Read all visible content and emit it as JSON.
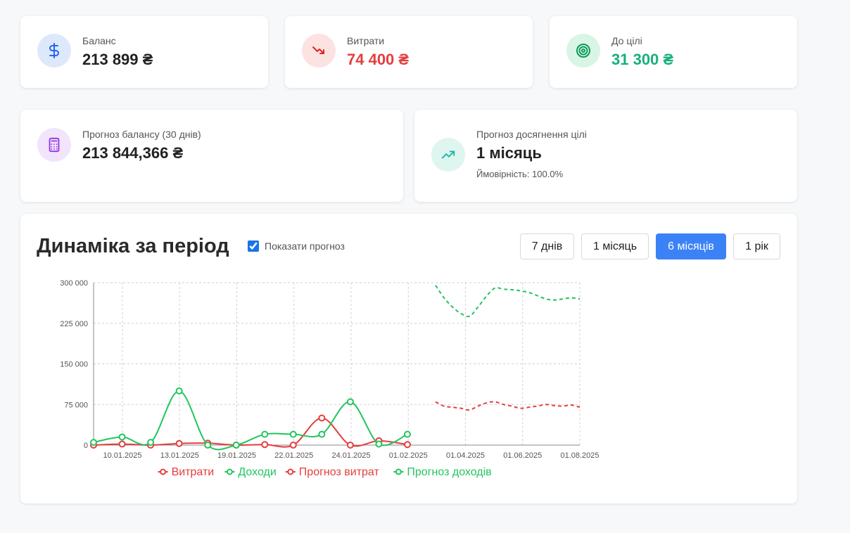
{
  "stats_row1": [
    {
      "label": "Баланс",
      "value": "213 899 ₴",
      "icon": "dollar-icon",
      "value_color": "#222222",
      "icon_bg": "#dde9fb",
      "icon_color": "#2563eb"
    },
    {
      "label": "Витрати",
      "value": "74 400 ₴",
      "icon": "trending-down-icon",
      "value_color": "#e53e3e",
      "icon_bg": "#fde2e2",
      "icon_color": "#dc2626"
    },
    {
      "label": "До цілі",
      "value": "31 300 ₴",
      "icon": "target-icon",
      "value_color": "#16b07a",
      "icon_bg": "#d8f5e6",
      "icon_color": "#0f9d58"
    }
  ],
  "forecast_balance": {
    "label": "Прогноз балансу (30 днів)",
    "value": "213 844,366 ₴",
    "icon": "calculator-icon",
    "icon_bg": "#f1e4fb",
    "icon_color": "#9333ea"
  },
  "goal_forecast": {
    "label": "Прогноз досягнення цілі",
    "value": "1 місяць",
    "probability": "Ймовірність: 100.0%",
    "icon": "trending-up-icon",
    "icon_bg": "#dff5ef",
    "icon_color": "#14b8a6"
  },
  "period": {
    "title": "Динаміка за період",
    "forecast_checkbox_label": "Показати прогноз",
    "forecast_checked": true,
    "buttons": [
      "7 днів",
      "1 місяць",
      "6 місяців",
      "1 рік"
    ],
    "active_button": "6 місяців"
  },
  "chart_data": {
    "type": "line",
    "y_ticks": [
      "300 000",
      "225 000",
      "150 000",
      "75 000",
      "0"
    ],
    "ylim": [
      0,
      300000
    ],
    "x_tick_labels": [
      "10.01.2025",
      "13.01.2025",
      "19.01.2025",
      "22.01.2025",
      "24.01.2025",
      "01.02.2025",
      "01.04.2025",
      "01.06.2025",
      "01.08.2025"
    ],
    "grid": true,
    "legend_position": "bottom",
    "series": [
      {
        "name": "Витрати",
        "color": "#e53e3e",
        "dashed": false,
        "values": [
          0,
          2000,
          0,
          3000,
          3500,
          0,
          1000,
          0,
          50000,
          0,
          8000,
          1000
        ]
      },
      {
        "name": "Доходи",
        "color": "#22c55e",
        "dashed": false,
        "values": [
          5000,
          15000,
          5000,
          100000,
          0,
          0,
          20000,
          20000,
          20000,
          80000,
          2000,
          20000
        ]
      },
      {
        "name": "Прогноз витрат",
        "color": "#e53e3e",
        "dashed": true,
        "values": [
          80000,
          72000,
          70000,
          68000,
          65000,
          72000,
          78000,
          80000,
          75000,
          72000,
          68000,
          70000,
          72000,
          75000,
          73000,
          72000,
          74000,
          70000
        ]
      },
      {
        "name": "Прогноз доходів",
        "color": "#22c55e",
        "dashed": true,
        "values": [
          295000,
          272000,
          255000,
          243000,
          238000,
          255000,
          275000,
          290000,
          288000,
          287000,
          285000,
          282000,
          276000,
          270000,
          268000,
          270000,
          272000,
          270000
        ]
      }
    ]
  }
}
